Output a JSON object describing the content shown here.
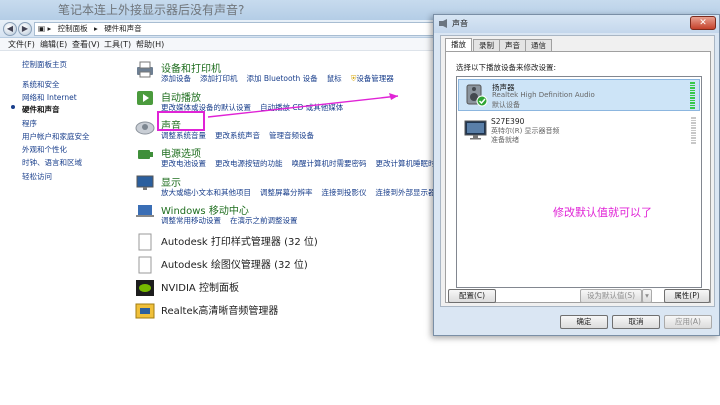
{
  "control_panel": {
    "heading": "笔记本连上外接显示器后没有声音?",
    "nav": {
      "back_icon": "back-arrow-icon",
      "forward_icon": "forward-arrow-icon"
    },
    "breadcrumb": [
      "控制面板",
      "硬件和声音"
    ],
    "menu": [
      "文件(F)",
      "编辑(E)",
      "查看(V)",
      "工具(T)",
      "帮助(H)"
    ],
    "sidebar": [
      "控制面板主页",
      "系统和安全",
      "网络和 Internet",
      "硬件和声音",
      "程序",
      "用户帐户和家庭安全",
      "外观和个性化",
      "时钟、语言和区域",
      "轻松访问"
    ],
    "categories": [
      {
        "title": "设备和打印机",
        "links": [
          "添加设备",
          "添加打印机",
          "添加 Bluetooth 设备",
          "鼠标",
          "设备管理器"
        ]
      },
      {
        "title": "自动播放",
        "links": [
          "更改媒体或设备的默认设置",
          "自动播放 CD 或其他媒体"
        ]
      },
      {
        "title": "声音",
        "links": [
          "调整系统音量",
          "更改系统声音",
          "管理音频设备"
        ]
      },
      {
        "title": "电源选项",
        "links": [
          "更改电池设置",
          "更改电源按钮的功能",
          "唤醒计算机时需要密码",
          "更改计算机睡眠时间"
        ]
      },
      {
        "title": "显示",
        "links": [
          "放大或缩小文本和其他项目",
          "调整屏幕分辨率",
          "连接到投影仪",
          "连接到外部显示器"
        ]
      },
      {
        "title": "Windows 移动中心",
        "links": [
          "调整常用移动设置",
          "在演示之前调整设置"
        ]
      },
      {
        "title": "Autodesk 打印样式管理器 (32 位)",
        "links": []
      },
      {
        "title": "Autodesk 绘图仪管理器 (32 位)",
        "links": []
      },
      {
        "title": "NVIDIA 控制面板",
        "links": []
      },
      {
        "title": "Realtek高清晰音频管理器",
        "links": []
      }
    ]
  },
  "dialog": {
    "title": "声音",
    "close_label": "✕",
    "tabs": [
      "播放",
      "录制",
      "声音",
      "通信"
    ],
    "instruction": "选择以下播放设备来修改设置:",
    "devices": [
      {
        "name": "扬声器",
        "sub": "Realtek High Definition Audio",
        "status": "默认设备",
        "icon": "speaker-icon",
        "default": true
      },
      {
        "name": "S27E390",
        "sub": "英特尔(R) 显示器音频",
        "status": "准备就绪",
        "icon": "monitor-icon",
        "default": false
      }
    ],
    "buttons": {
      "configure": "配置(C)",
      "set_default": "设为默认值(S)",
      "properties": "属性(P)",
      "ok": "确定",
      "cancel": "取消",
      "apply": "应用(A)"
    }
  },
  "annotation": "修改默认值就可以了",
  "colors": {
    "highlight": "#e023d6",
    "link": "#1a3f8c",
    "category_title": "#1f6e1f"
  }
}
